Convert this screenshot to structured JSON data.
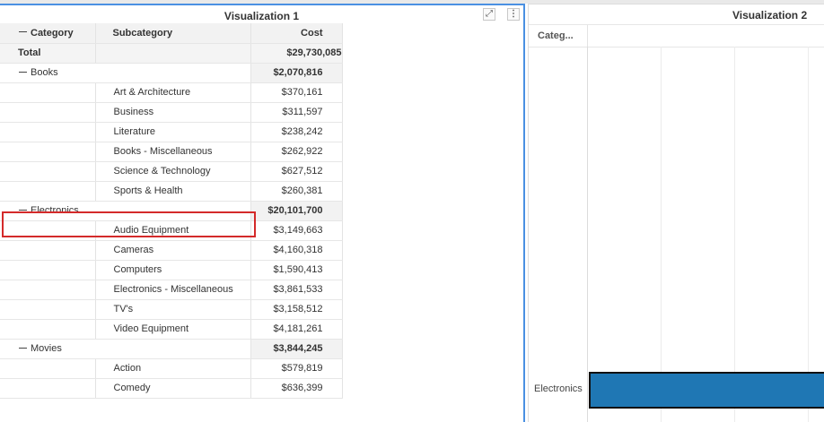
{
  "visualization1": {
    "title": "Visualization 1",
    "expand_icon": "expand-icon",
    "menu_icon": "more-vertical-icon",
    "columns": [
      "Category",
      "Subcategory",
      "Cost"
    ],
    "total": {
      "label": "Total",
      "value": "$29,730,085"
    },
    "groups": [
      {
        "category": "Books",
        "value": "$2,070,816",
        "rows": [
          {
            "sub": "Art & Architecture",
            "value": "$370,161"
          },
          {
            "sub": "Business",
            "value": "$311,597"
          },
          {
            "sub": "Literature",
            "value": "$238,242"
          },
          {
            "sub": "Books - Miscellaneous",
            "value": "$262,922"
          },
          {
            "sub": "Science & Technology",
            "value": "$627,512"
          },
          {
            "sub": "Sports & Health",
            "value": "$260,381"
          }
        ]
      },
      {
        "category": "Electronics",
        "value": "$20,101,700",
        "rows": [
          {
            "sub": "Audio Equipment",
            "value": "$3,149,663"
          },
          {
            "sub": "Cameras",
            "value": "$4,160,318"
          },
          {
            "sub": "Computers",
            "value": "$1,590,413"
          },
          {
            "sub": "Electronics - Miscellaneous",
            "value": "$3,861,533"
          },
          {
            "sub": "TV's",
            "value": "$3,158,512"
          },
          {
            "sub": "Video Equipment",
            "value": "$4,181,261"
          }
        ]
      },
      {
        "category": "Movies",
        "value": "$3,844,245",
        "rows": [
          {
            "sub": "Action",
            "value": "$579,819"
          },
          {
            "sub": "Comedy",
            "value": "$636,399"
          }
        ]
      }
    ],
    "highlight_color": "#d42a2a",
    "accent_color": "#4a90e2"
  },
  "visualization2": {
    "title": "Visualization 2",
    "column_header": "Categ...",
    "category_label": "Electronics",
    "bar_color": "#1f77b4"
  }
}
